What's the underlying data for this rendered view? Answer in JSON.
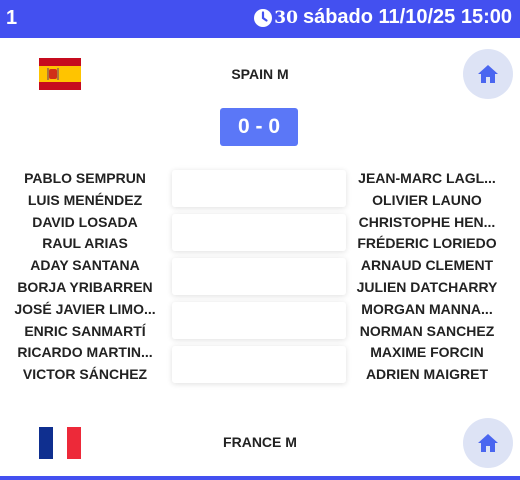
{
  "header": {
    "number": "1",
    "clock_icon": "clock-icon",
    "minutes": "30",
    "datetime": "sábado 11/10/25 15:00"
  },
  "home_team": {
    "name": "SPAIN M",
    "flag": "spain-flag"
  },
  "away_team": {
    "name": "FRANCE M",
    "flag": "france-flag"
  },
  "score": "0 - 0",
  "home_players": [
    "PABLO SEMPRUN",
    "LUIS MENÉNDEZ",
    "DAVID LOSADA",
    "RAUL ARIAS",
    "ADAY SANTANA",
    "BORJA YRIBARREN",
    "JOSÉ JAVIER LIMO...",
    "ENRIC SANMARTÍ",
    "RICARDO MARTIN...",
    "VICTOR SÁNCHEZ"
  ],
  "away_players": [
    "JEAN-MARC LAGL...",
    "OLIVIER LAUNO",
    "CHRISTOPHE HEN...",
    "FRÉDERIC LORIEDO",
    "ARNAUD CLEMENT",
    "JULIEN DATCHARRY",
    "MORGAN MANNA...",
    "NORMAN SANCHEZ",
    "MAXIME FORCIN",
    "ADRIEN MAIGRET"
  ],
  "colors": {
    "header_bg": "#4350f0",
    "score_bg": "#5b77f7",
    "home_icon": "#4a66f0",
    "home_btn_bg": "#dde3f5"
  }
}
